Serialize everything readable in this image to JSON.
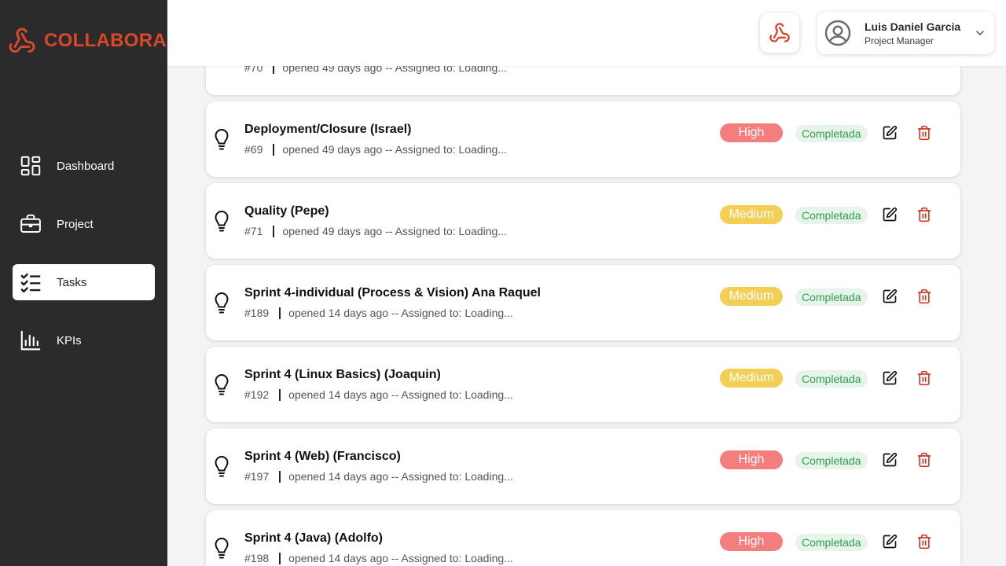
{
  "app": {
    "brand": "COLLABORA"
  },
  "sidebar": {
    "items": [
      {
        "label": "Dashboard",
        "icon": "dashboard-icon",
        "active": false
      },
      {
        "label": "Project",
        "icon": "briefcase-icon",
        "active": false
      },
      {
        "label": "Tasks",
        "icon": "checklist-icon",
        "active": true
      },
      {
        "label": "KPIs",
        "icon": "bar-chart-icon",
        "active": false
      }
    ]
  },
  "header": {
    "user": {
      "name": "Luis Daniel Garcia",
      "role": "Project Manager"
    }
  },
  "colors": {
    "brand": "#d9482b",
    "sidebar_bg": "#2a2b2a",
    "priority_high": "#f47e7e",
    "priority_medium": "#f3cf55",
    "status_bg": "#e6f4ea",
    "status_text": "#2e9f4f"
  },
  "tasks": [
    {
      "title": "",
      "id": "#70",
      "meta": "opened 49 days ago -- Assigned to: Loading...",
      "priority": "",
      "status": ""
    },
    {
      "title": "Deployment/Closure (Israel)",
      "id": "#69",
      "meta": "opened 49 days ago -- Assigned to: Loading...",
      "priority": "High",
      "status": "Completada"
    },
    {
      "title": "Quality (Pepe)",
      "id": "#71",
      "meta": "opened 49 days ago -- Assigned to: Loading...",
      "priority": "Medium",
      "status": "Completada"
    },
    {
      "title": "Sprint 4-individual (Process & Vision) Ana Raquel",
      "id": "#189",
      "meta": "opened 14 days ago -- Assigned to: Loading...",
      "priority": "Medium",
      "status": "Completada"
    },
    {
      "title": "Sprint 4 (Linux Basics) (Joaquin)",
      "id": "#192",
      "meta": "opened 14 days ago -- Assigned to: Loading...",
      "priority": "Medium",
      "status": "Completada"
    },
    {
      "title": "Sprint 4 (Web) (Francisco)",
      "id": "#197",
      "meta": "opened 14 days ago -- Assigned to: Loading...",
      "priority": "High",
      "status": "Completada"
    },
    {
      "title": "Sprint 4 (Java) (Adolfo)",
      "id": "#198",
      "meta": "opened 14 days ago -- Assigned to: Loading...",
      "priority": "High",
      "status": "Completada"
    }
  ]
}
